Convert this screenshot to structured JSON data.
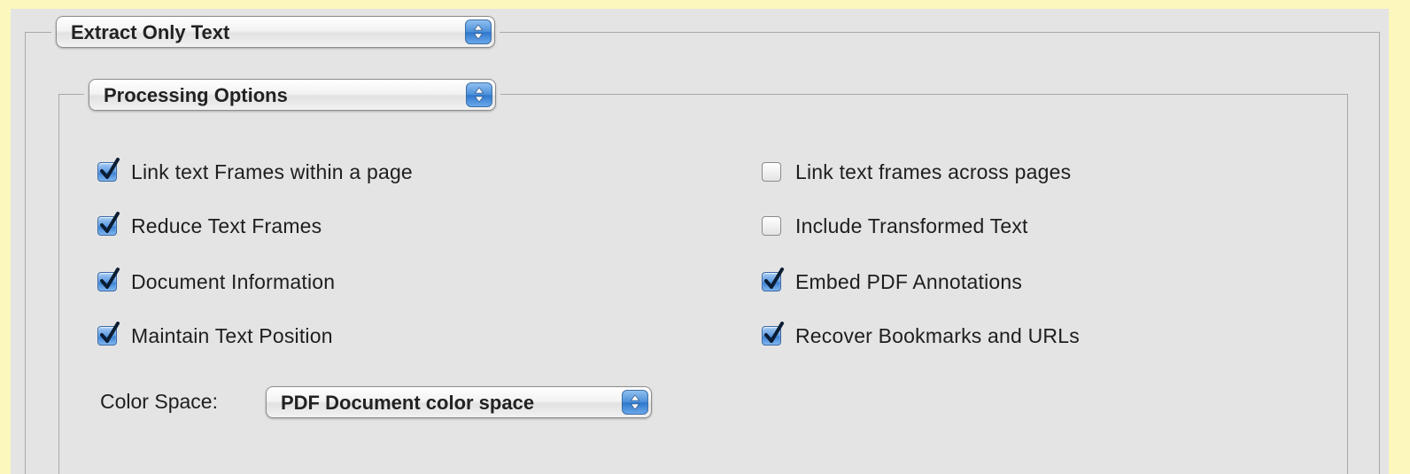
{
  "extract_popup": {
    "selected": "Extract Only Text"
  },
  "options_popup": {
    "selected": "Processing Options"
  },
  "options": {
    "left": [
      {
        "label": "Link text Frames within a page",
        "checked": true
      },
      {
        "label": "Reduce Text Frames",
        "checked": true
      },
      {
        "label": "Document Information",
        "checked": true
      },
      {
        "label": "Maintain Text Position",
        "checked": true
      }
    ],
    "right": [
      {
        "label": "Link text frames across pages",
        "checked": false
      },
      {
        "label": "Include Transformed Text",
        "checked": false
      },
      {
        "label": "Embed PDF Annotations",
        "checked": true
      },
      {
        "label": "Recover Bookmarks and URLs",
        "checked": true
      }
    ]
  },
  "color_space": {
    "label": "Color Space:",
    "selected": "PDF Document color space"
  },
  "icons": {
    "popup_arrows": "up-down-arrows-icon",
    "checkmark": "checkmark-icon"
  },
  "colors": {
    "accent_blue": "#3b81d4",
    "frame_yellow": "#fcf7bd",
    "panel_gray": "#e4e4e4"
  }
}
